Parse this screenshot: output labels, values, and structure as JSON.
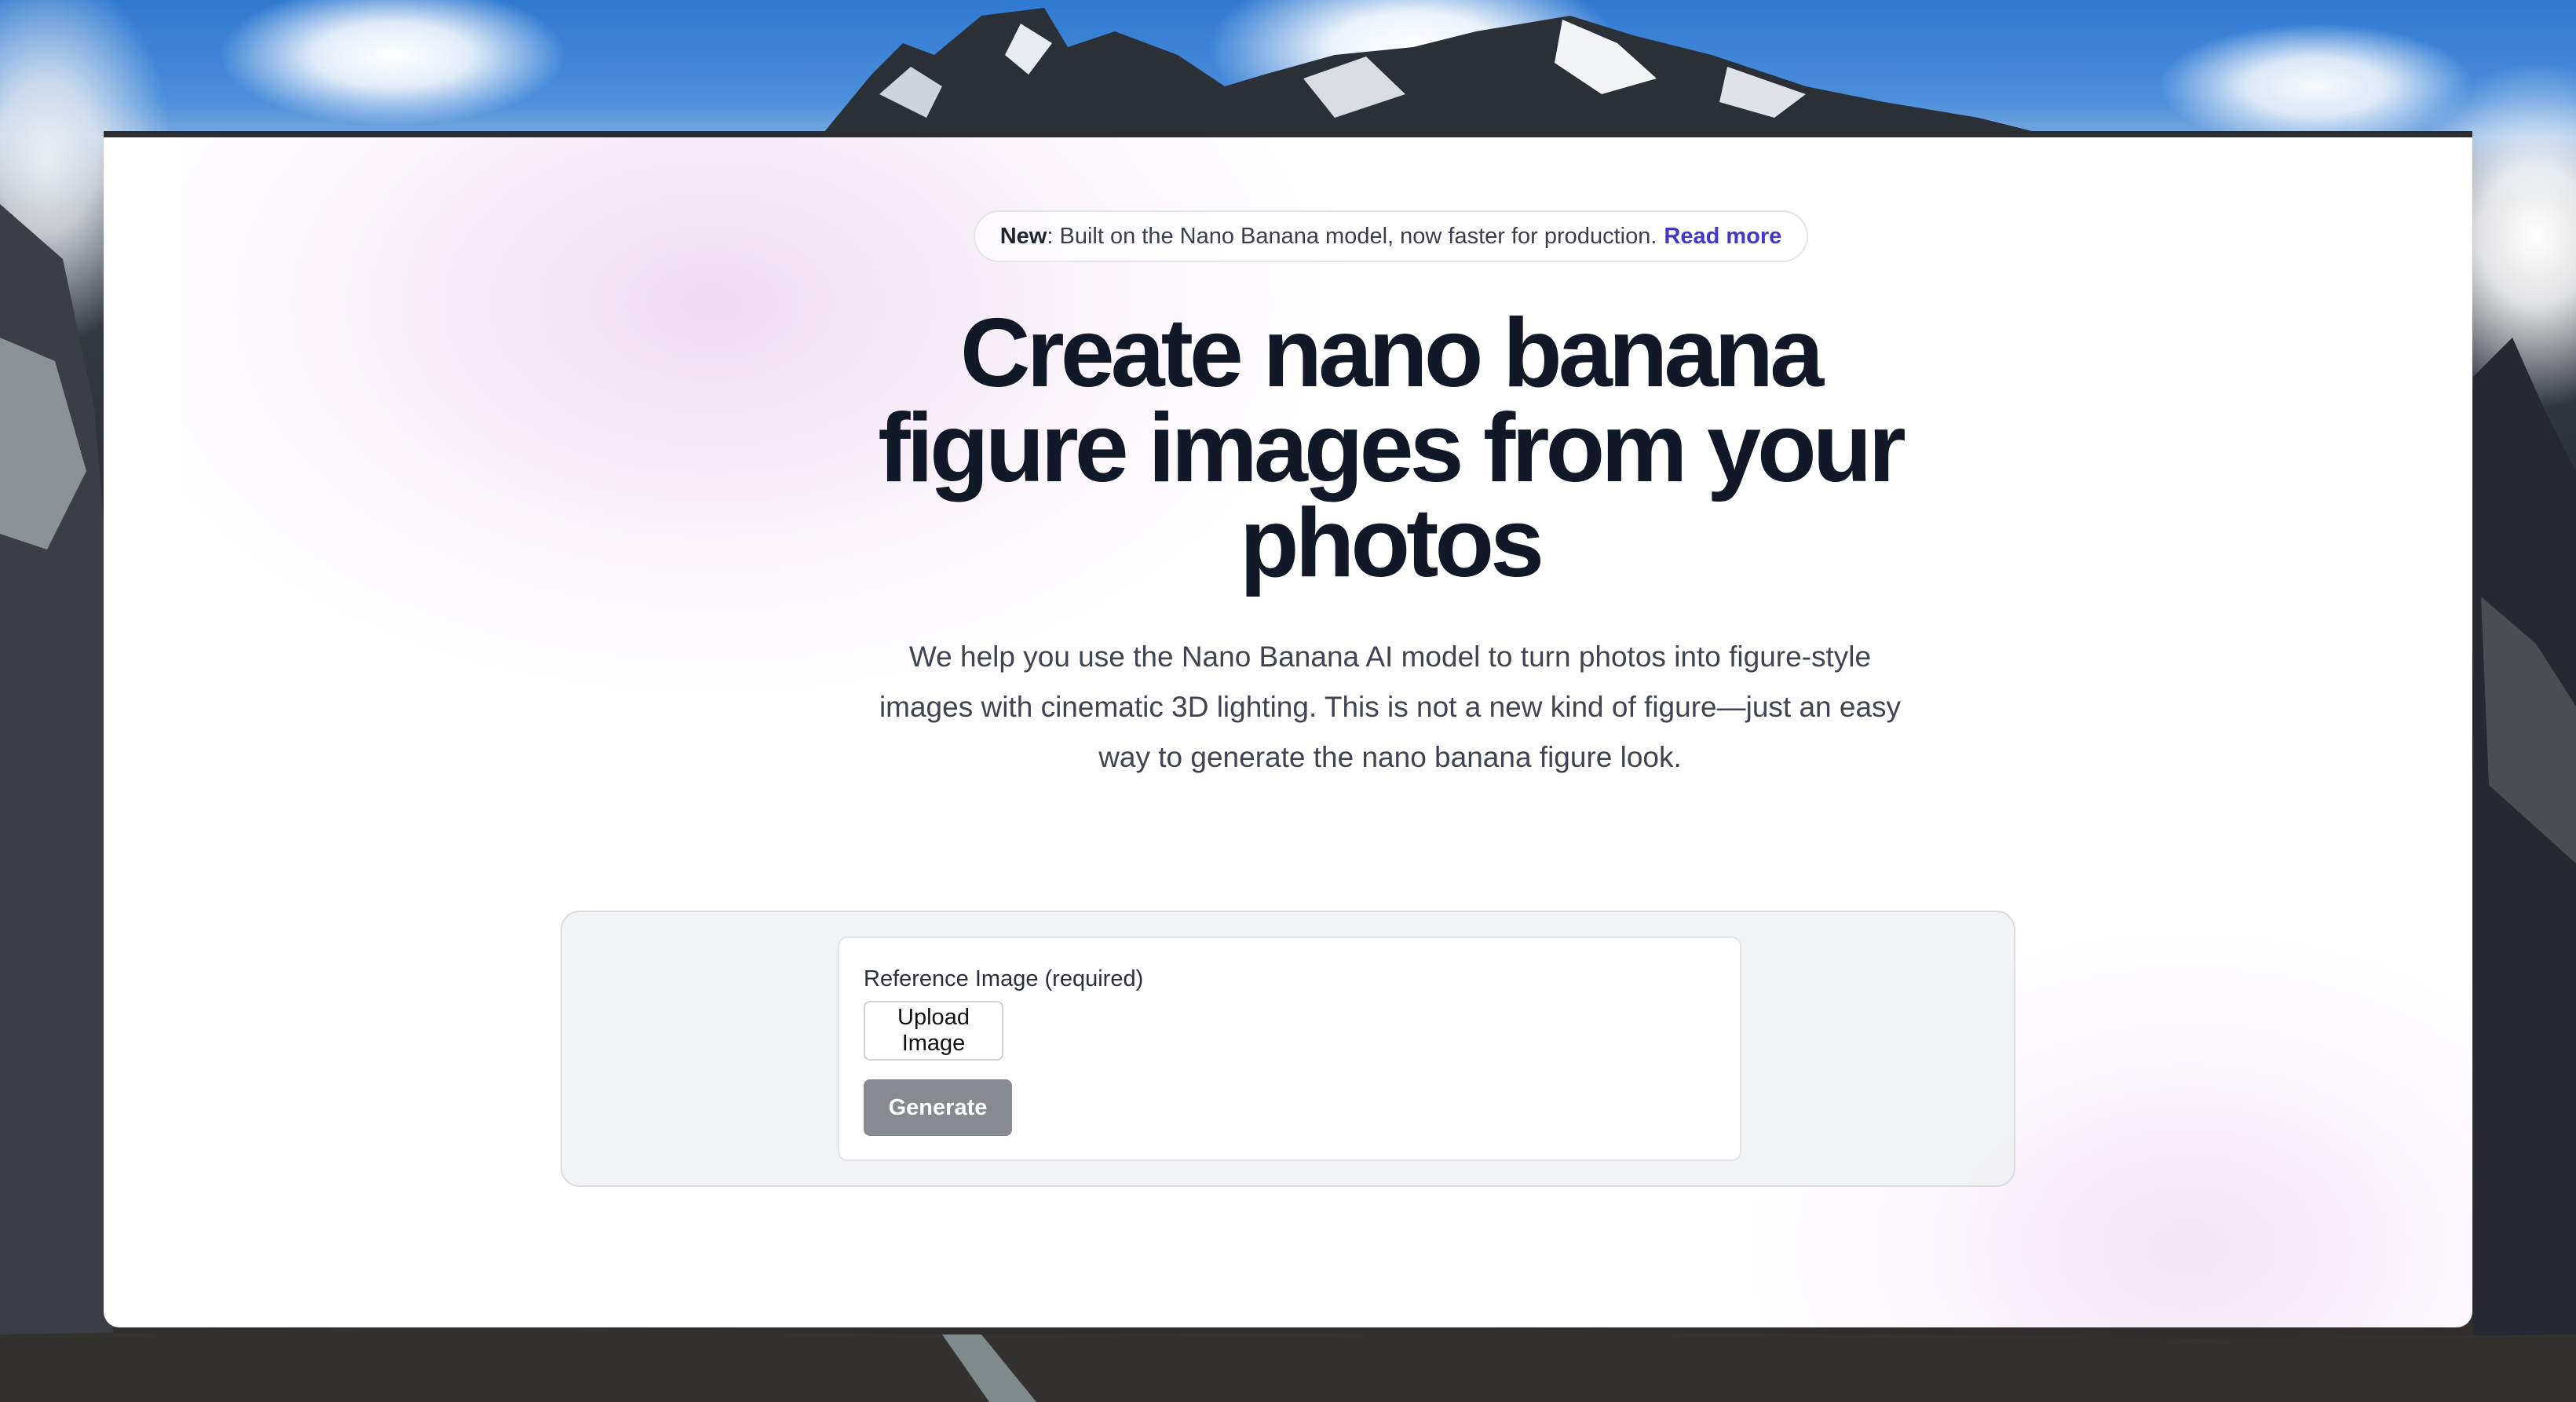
{
  "banner": {
    "badge": "New",
    "text": ": Built on the Nano Banana model, now faster for production.",
    "link_label": "Read more",
    "link_color": "#4338ca"
  },
  "hero": {
    "title_lines": [
      "Create nano banana",
      "figure images from your",
      "photos"
    ],
    "subtitle_lines": [
      "We help you use the Nano Banana AI model to turn photos into figure-style",
      "images with cinematic 3D lighting. This is not a new kind of figure—just an easy",
      "way to generate the nano banana figure look."
    ]
  },
  "form": {
    "reference_label": "Reference Image (required)",
    "upload_label": "Upload Image",
    "generate_label": "Generate",
    "generate_disabled": true
  },
  "colors": {
    "title_text": "#111827",
    "body_text": "#3f4450",
    "generate_button": "#878a90"
  }
}
